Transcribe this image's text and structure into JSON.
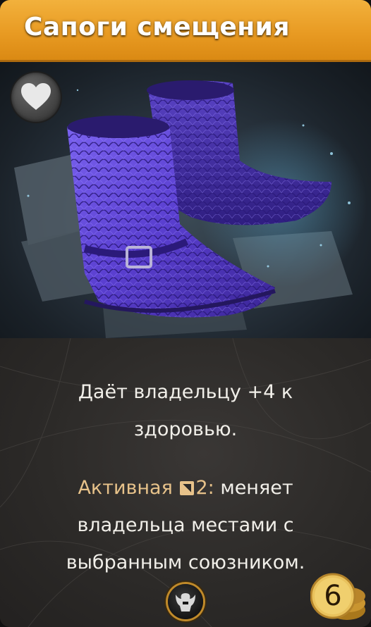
{
  "card": {
    "title": "Сапоги смещения",
    "description_line1": "Даёт владельцу +4 к здоровью.",
    "ability_keyword": "Активная",
    "ability_cooldown": "2:",
    "ability_text": "меняет владельца местами с выбранным союзником.",
    "gold_cost": "6",
    "colors": {
      "header": "#e89a22",
      "keyword": "#e7c28a",
      "body_text": "#f1efe9",
      "boots": "#5a3fd0"
    },
    "icons": {
      "top_left": "heart-icon",
      "bottom_center": "hero-helmet-icon",
      "bottom_right": "gold-coins-icon",
      "inline": "cooldown-icon"
    }
  }
}
